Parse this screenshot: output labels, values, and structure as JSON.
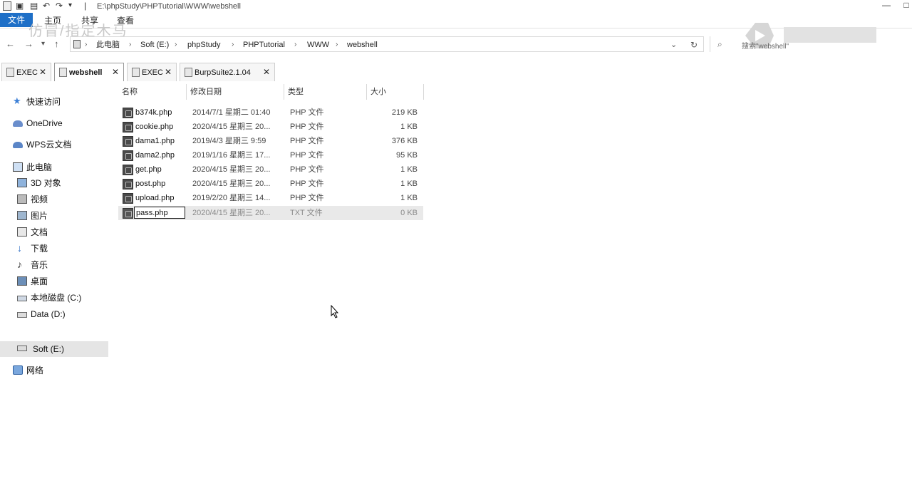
{
  "window": {
    "title": "E:\\phpStudy\\PHPTutorial\\WWW\\webshell",
    "minimize": "—",
    "restore": "□"
  },
  "ribbon": {
    "tabs": [
      "文件",
      "主页",
      "共享",
      "查看"
    ],
    "ghost_text": "仿冒/指定木马"
  },
  "address": {
    "crumbs": [
      "此电脑",
      "Soft (E:)",
      "phpStudy",
      "PHPTutorial",
      "WWW",
      "webshell"
    ],
    "search_placeholder": "搜索\"webshell\""
  },
  "file_tabs": [
    {
      "label": "EXEC",
      "active": false
    },
    {
      "label": "webshell",
      "active": true
    },
    {
      "label": "EXEC",
      "active": false
    },
    {
      "label": "BurpSuite2.1.04",
      "active": false
    }
  ],
  "nav": {
    "quick_access": "快速访问",
    "onedrive": "OneDrive",
    "wps": "WPS云文档",
    "this_pc": "此电脑",
    "items": [
      "3D 对象",
      "视频",
      "图片",
      "文档",
      "下载",
      "音乐",
      "桌面"
    ],
    "drive_c": "本地磁盘 (C:)",
    "drive_d": "Data (D:)",
    "drive_e": "Soft (E:)",
    "network": "网络"
  },
  "columns": {
    "name": "名称",
    "date": "修改日期",
    "type": "类型",
    "size": "大小"
  },
  "files": [
    {
      "name": "b374k.php",
      "date": "2014/7/1 星期二 01:40",
      "type": "PHP 文件",
      "size": "219 KB"
    },
    {
      "name": "cookie.php",
      "date": "2020/4/15 星期三 20...",
      "type": "PHP 文件",
      "size": "1 KB"
    },
    {
      "name": "dama1.php",
      "date": "2019/4/3 星期三 9:59",
      "type": "PHP 文件",
      "size": "376 KB"
    },
    {
      "name": "dama2.php",
      "date": "2019/1/16 星期三 17...",
      "type": "PHP 文件",
      "size": "95 KB"
    },
    {
      "name": "get.php",
      "date": "2020/4/15 星期三 20...",
      "type": "PHP 文件",
      "size": "1 KB"
    },
    {
      "name": "post.php",
      "date": "2020/4/15 星期三 20...",
      "type": "PHP 文件",
      "size": "1 KB"
    },
    {
      "name": "upload.php",
      "date": "2019/2/20 星期三 14...",
      "type": "PHP 文件",
      "size": "1 KB"
    },
    {
      "name": "pass.php",
      "date": "2020/4/15 星期三 20...",
      "type": "TXT 文件",
      "size": "0 KB"
    }
  ],
  "colors": {
    "accent": "#1e6fc7",
    "selection": "#e5e5e5"
  }
}
